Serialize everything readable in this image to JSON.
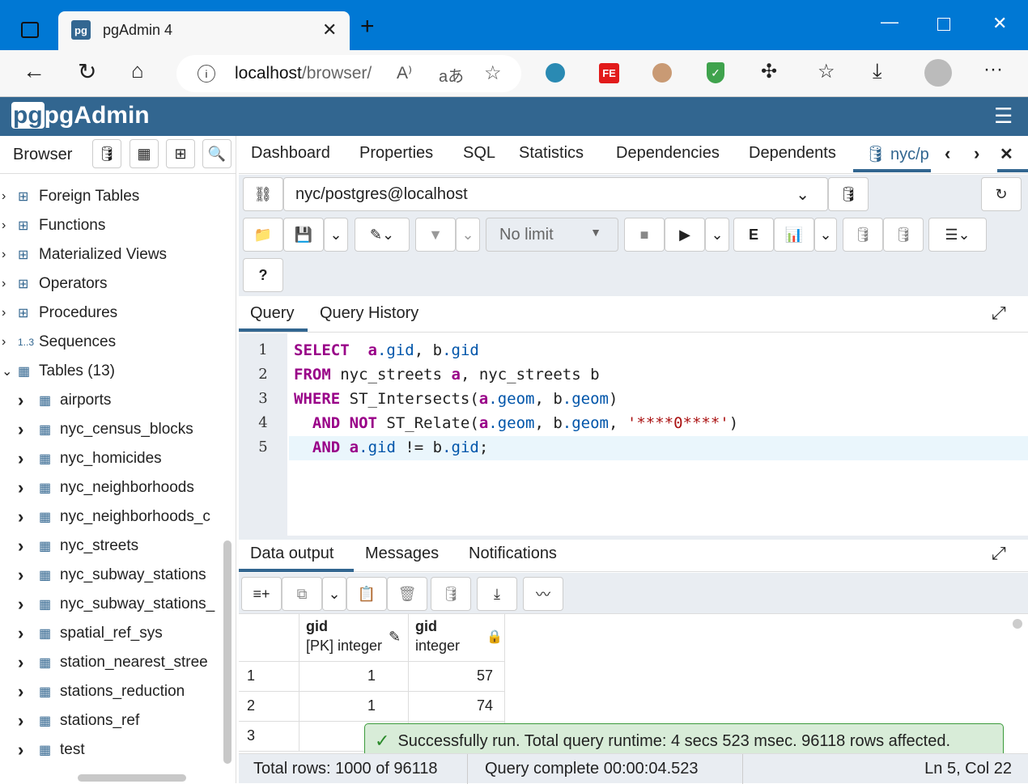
{
  "window": {
    "tab_title": "pgAdmin 4",
    "url_host": "localhost",
    "url_path": "/browser/"
  },
  "app": {
    "logo_text": "pgAdmin"
  },
  "browser": {
    "title": "Browser",
    "tree": [
      {
        "label": "Foreign Tables",
        "icon": "foreign-table-icon",
        "level": 0
      },
      {
        "label": "Functions",
        "icon": "function-icon",
        "level": 0
      },
      {
        "label": "Materialized Views",
        "icon": "mview-icon",
        "level": 0
      },
      {
        "label": "Operators",
        "icon": "operator-icon",
        "level": 0
      },
      {
        "label": "Procedures",
        "icon": "procedure-icon",
        "level": 0
      },
      {
        "label": "Sequences",
        "icon": "sequence-icon",
        "level": 0
      },
      {
        "label": "Tables (13)",
        "icon": "tables-icon",
        "level": 0,
        "expanded": true
      },
      {
        "label": "airports",
        "icon": "table-icon",
        "level": 1
      },
      {
        "label": "nyc_census_blocks",
        "icon": "table-icon",
        "level": 1
      },
      {
        "label": "nyc_homicides",
        "icon": "table-icon",
        "level": 1
      },
      {
        "label": "nyc_neighborhoods",
        "icon": "table-icon",
        "level": 1
      },
      {
        "label": "nyc_neighborhoods_c",
        "icon": "table-icon",
        "level": 1
      },
      {
        "label": "nyc_streets",
        "icon": "table-icon",
        "level": 1
      },
      {
        "label": "nyc_subway_stations",
        "icon": "table-icon",
        "level": 1
      },
      {
        "label": "nyc_subway_stations_",
        "icon": "table-icon",
        "level": 1
      },
      {
        "label": "spatial_ref_sys",
        "icon": "table-icon",
        "level": 1
      },
      {
        "label": "station_nearest_stree",
        "icon": "table-icon",
        "level": 1
      },
      {
        "label": "stations_reduction",
        "icon": "table-icon",
        "level": 1
      },
      {
        "label": "stations_ref",
        "icon": "table-icon",
        "level": 1
      },
      {
        "label": "test",
        "icon": "table-icon",
        "level": 1
      }
    ]
  },
  "main_tabs": [
    "Dashboard",
    "Properties",
    "SQL",
    "Statistics",
    "Dependencies",
    "Dependents",
    "nyc/p"
  ],
  "query_tool": {
    "connection": "nyc/postgres@localhost",
    "limit": "No limit",
    "editor_tabs": [
      "Query",
      "Query History"
    ],
    "code": [
      [
        [
          "kw",
          "SELECT"
        ],
        [
          "",
          "  "
        ],
        [
          "al",
          "a"
        ],
        [
          "pr",
          ".gid"
        ],
        [
          "",
          ", b"
        ],
        [
          "pr",
          ".gid"
        ]
      ],
      [
        [
          "kw",
          "FROM"
        ],
        [
          "",
          " nyc_streets "
        ],
        [
          "al",
          "a"
        ],
        [
          "",
          ", nyc_streets b"
        ]
      ],
      [
        [
          "kw",
          "WHERE"
        ],
        [
          "",
          " ST_Intersects("
        ],
        [
          "al",
          "a"
        ],
        [
          "pr",
          ".geom"
        ],
        [
          "",
          ", b"
        ],
        [
          "pr",
          ".geom"
        ],
        [
          "",
          ")"
        ]
      ],
      [
        [
          "",
          "  "
        ],
        [
          "kw",
          "AND NOT"
        ],
        [
          "",
          " ST_Relate("
        ],
        [
          "al",
          "a"
        ],
        [
          "pr",
          ".geom"
        ],
        [
          "",
          ", b"
        ],
        [
          "pr",
          ".geom"
        ],
        [
          "",
          ", "
        ],
        [
          "st",
          "'****0****'"
        ],
        [
          "",
          ")"
        ]
      ],
      [
        [
          "",
          "  "
        ],
        [
          "kw",
          "AND"
        ],
        [
          "",
          " "
        ],
        [
          "al",
          "a"
        ],
        [
          "pr",
          ".gid"
        ],
        [
          "",
          " != b"
        ],
        [
          "pr",
          ".gid"
        ],
        [
          "",
          ";"
        ]
      ]
    ],
    "line_numbers": [
      "1",
      "2",
      "3",
      "4",
      "5"
    ],
    "result_tabs": [
      "Data output",
      "Messages",
      "Notifications"
    ],
    "columns": [
      {
        "name": "gid",
        "type": "[PK] integer"
      },
      {
        "name": "gid",
        "type": "integer"
      }
    ],
    "rows": [
      [
        "1",
        "1",
        "57"
      ],
      [
        "2",
        "1",
        "74"
      ],
      [
        "3",
        "",
        ""
      ]
    ],
    "toast": "Successfully run. Total query runtime: 4 secs 523 msec. 96118 rows affected.",
    "status": {
      "total_rows": "Total rows: 1000 of 96118",
      "query_complete": "Query complete 00:00:04.523",
      "cursor": "Ln 5, Col 22"
    }
  }
}
